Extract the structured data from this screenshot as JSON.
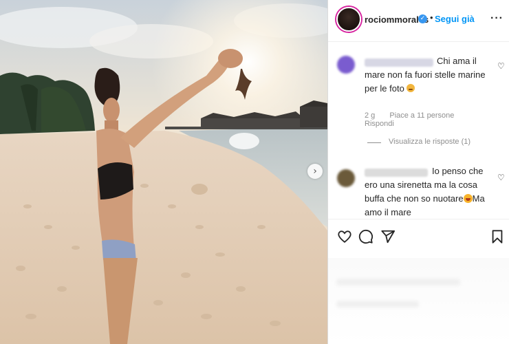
{
  "post": {
    "username": "rociommorales",
    "verified": true,
    "separator": "•",
    "follow_label": "Segui già",
    "more_icon": "more-horizontal-icon"
  },
  "comments": [
    {
      "text": "Chi ama il mare non fa fuori stelle marine per le foto",
      "emoji": "worried-face",
      "time": "2 g",
      "likes": "Piace a 11 persone",
      "reply_label": "Rispondi",
      "view_replies": "Visualizza le risposte (1)"
    },
    {
      "text": "Io penso che ero una sirenetta ma la cosa buffa che non so nuotare",
      "emoji": "laughing-face",
      "text_after": "Ma amo il mare"
    }
  ],
  "actions": [
    "heart-icon",
    "comment-icon",
    "share-icon",
    "bookmark-icon"
  ],
  "colors": {
    "accent": "#0095f6",
    "verified": "#3897f0",
    "meta": "#8e8e8e",
    "text": "#262626"
  }
}
